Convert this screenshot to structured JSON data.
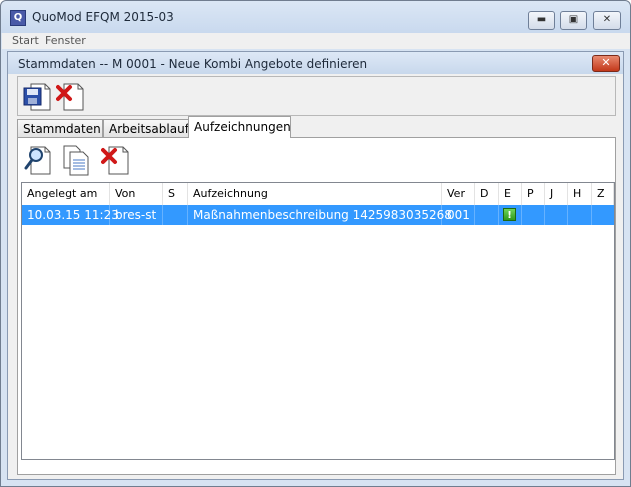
{
  "app": {
    "title": "QuoMod EFQM 2015-03",
    "icon_letter": "Q"
  },
  "window_controls": {
    "minimize": "▬",
    "maximize": "▣",
    "close": "✕"
  },
  "menu": [
    {
      "label": "Start"
    },
    {
      "label": "Fenster"
    }
  ],
  "inner_window": {
    "title": "Stammdaten -- M 0001 - Neue Kombi Angebote definieren",
    "close": "✕"
  },
  "toolbar1": {
    "items": [
      {
        "name": "save",
        "icon": "floppy-disk-icon"
      },
      {
        "name": "delete",
        "icon": "delete-document-icon"
      }
    ]
  },
  "tabs": [
    {
      "label": "Stammdaten",
      "active": false
    },
    {
      "label": "Arbeitsablauf",
      "active": false
    },
    {
      "label": "Aufzeichnungen",
      "active": true
    }
  ],
  "toolbar2": {
    "items": [
      {
        "name": "view",
        "icon": "magnifier-document-icon"
      },
      {
        "name": "copy",
        "icon": "copy-documents-icon"
      },
      {
        "name": "delete",
        "icon": "delete-document-icon"
      }
    ]
  },
  "table": {
    "columns": [
      "Angelegt am",
      "Von",
      "S",
      "Aufzeichnung",
      "Ver",
      "D",
      "E",
      "P",
      "J",
      "H",
      "Z"
    ],
    "rows": [
      {
        "angelegt_am": "10.03.15 11:23",
        "von": "bres-st",
        "s": "",
        "aufzeichnung": "Maßnahmenbeschreibung 1425983035268",
        "ver": "001",
        "e_flag": "!",
        "selected": true
      }
    ]
  },
  "colors": {
    "selection": "#3399ff",
    "flag_green": "#2f9a1c",
    "close_red": "#c2381a"
  }
}
